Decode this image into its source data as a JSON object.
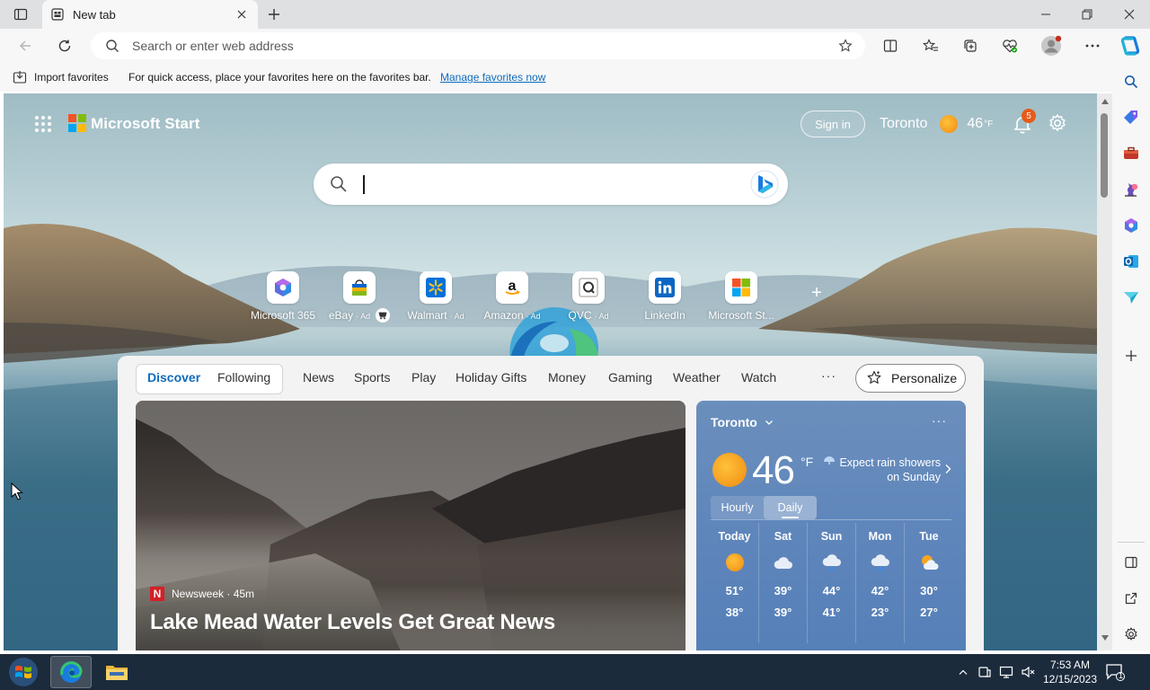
{
  "browser": {
    "tab_title": "New tab",
    "address_placeholder": "Search or enter web address"
  },
  "favorites_bar": {
    "import_label": "Import favorites",
    "hint": "For quick access, place your favorites here on the favorites bar.",
    "manage_link": "Manage favorites now"
  },
  "start": {
    "brand": "Microsoft Start",
    "sign_in": "Sign in",
    "city": "Toronto",
    "temp": "46",
    "temp_unit": "°F",
    "notification_count": "5"
  },
  "quick_links": [
    {
      "label": "Microsoft 365",
      "ad": ""
    },
    {
      "label": "eBay",
      "ad": "· Ad"
    },
    {
      "label": "Walmart",
      "ad": "· Ad"
    },
    {
      "label": "Amazon",
      "ad": "· Ad"
    },
    {
      "label": "QVC",
      "ad": "· Ad"
    },
    {
      "label": "LinkedIn",
      "ad": ""
    },
    {
      "label": "Microsoft St...",
      "ad": ""
    }
  ],
  "feed": {
    "tabs": [
      "Discover",
      "Following"
    ],
    "categories": [
      "News",
      "Sports",
      "Play",
      "Holiday Gifts",
      "Money",
      "Gaming",
      "Weather",
      "Watch"
    ],
    "more": "···",
    "personalize": "Personalize"
  },
  "hero": {
    "source": "Newsweek",
    "age": "· 45m",
    "headline": "Lake Mead Water Levels Get Great News"
  },
  "weather_card": {
    "city": "Toronto",
    "temp": "46",
    "unit": "°F",
    "forecast_line1": "Expect rain showers",
    "forecast_line2": "on Sunday",
    "hourly": "Hourly",
    "daily": "Daily",
    "days": [
      {
        "name": "Today",
        "icon": "sun-icon",
        "high": "51°",
        "low": "38°"
      },
      {
        "name": "Sat",
        "icon": "cloud-icon",
        "high": "39°",
        "low": "39°"
      },
      {
        "name": "Sun",
        "icon": "rain-icon",
        "high": "44°",
        "low": "41°"
      },
      {
        "name": "Mon",
        "icon": "rain-icon",
        "high": "42°",
        "low": "23°"
      },
      {
        "name": "Tue",
        "icon": "partly-cloudy-icon",
        "high": "30°",
        "low": "27°"
      }
    ]
  },
  "taskbar": {
    "time": "7:53 AM",
    "date": "12/15/2023",
    "notification_count": "1"
  },
  "colors": {
    "accent": "#0f6cbd",
    "sun": "#f5a623",
    "taskbar": "#1c2b3c"
  }
}
